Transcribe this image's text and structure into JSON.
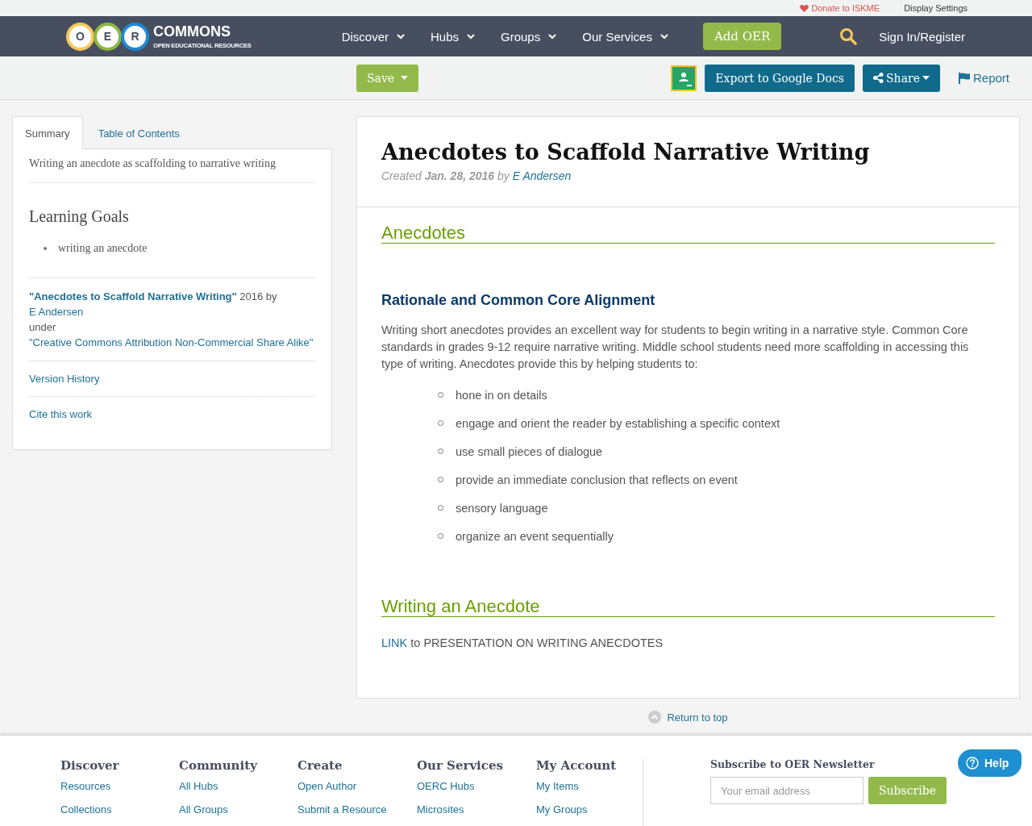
{
  "top_links": {
    "donate": "Donate to ISKME",
    "display_settings": "Display Settings"
  },
  "nav": {
    "logo": {
      "letters": [
        "O",
        "E",
        "R"
      ],
      "title": "COMMONS",
      "subtitle": "OPEN EDUCATIONAL RESOURCES"
    },
    "menus": [
      "Discover",
      "Hubs",
      "Groups",
      "Our Services"
    ],
    "add_button": "Add OER",
    "sign_in": "Sign In/Register"
  },
  "toolbar": {
    "save": "Save",
    "export": "Export to Google Docs",
    "share": "Share",
    "report": "Report"
  },
  "sidebar": {
    "tabs": [
      {
        "label": "Summary",
        "selected": true
      },
      {
        "label": "Table of Contents",
        "selected": false
      }
    ],
    "summary": "Writing an anecdote as scaffolding to narrative writing",
    "goals_title": "Learning Goals",
    "goals": [
      "writing an anecdote"
    ],
    "attribution": {
      "title": "\"Anecdotes to Scaffold Narrative Writing\"",
      "year_by": "2016 by",
      "author": "E Andersen",
      "under": "under",
      "license": "\"Creative Commons Attribution Non-Commercial Share Alike\""
    },
    "links": [
      "Version History",
      "Cite this work"
    ]
  },
  "article": {
    "title": "Anecdotes to Scaffold Narrative Writing",
    "meta": {
      "created": "Created",
      "date": "Jan. 28, 2016",
      "by": "by",
      "author": "E Andersen"
    },
    "sections": [
      {
        "heading": "Anecdotes",
        "blocks": [
          {
            "kind": "subheading",
            "text": "Rationale and Common Core Alignment"
          },
          {
            "kind": "paragraph",
            "text": "Writing short anecdotes provides an excellent way for students to begin writing in a narrative style. Common Core standards in grades 9-12 require narrative writing. Middle school students need more scaffolding in accessing this type of writing.  Anecdotes provide this by helping students to:"
          },
          {
            "kind": "list",
            "items": [
              "hone in on details",
              "engage and orient  the reader by establishing a specific context",
              "use small pieces of dialogue",
              "provide an immediate conclusion that reflects on event",
              "sensory language",
              "organize an event sequentially"
            ]
          }
        ]
      },
      {
        "heading": "Writing an Anecdote",
        "blocks": [
          {
            "kind": "link_paragraph",
            "link": "LINK",
            "text": "to PRESENTATION ON WRITING ANECDOTES"
          }
        ]
      }
    ]
  },
  "return_to_top": "Return to top",
  "footer": {
    "columns": [
      {
        "title": "Discover",
        "links": [
          "Resources",
          "Collections"
        ]
      },
      {
        "title": "Community",
        "links": [
          "All Hubs",
          "All Groups"
        ]
      },
      {
        "title": "Create",
        "links": [
          "Open Author",
          "Submit a Resource"
        ]
      },
      {
        "title": "Our Services",
        "links": [
          "OERC Hubs",
          "Microsites"
        ]
      },
      {
        "title": "My Account",
        "links": [
          "My Items",
          "My Groups"
        ]
      }
    ],
    "newsletter": {
      "title": "Subscribe to OER Newsletter",
      "placeholder": "Your email address",
      "button": "Subscribe"
    }
  },
  "help": "Help"
}
